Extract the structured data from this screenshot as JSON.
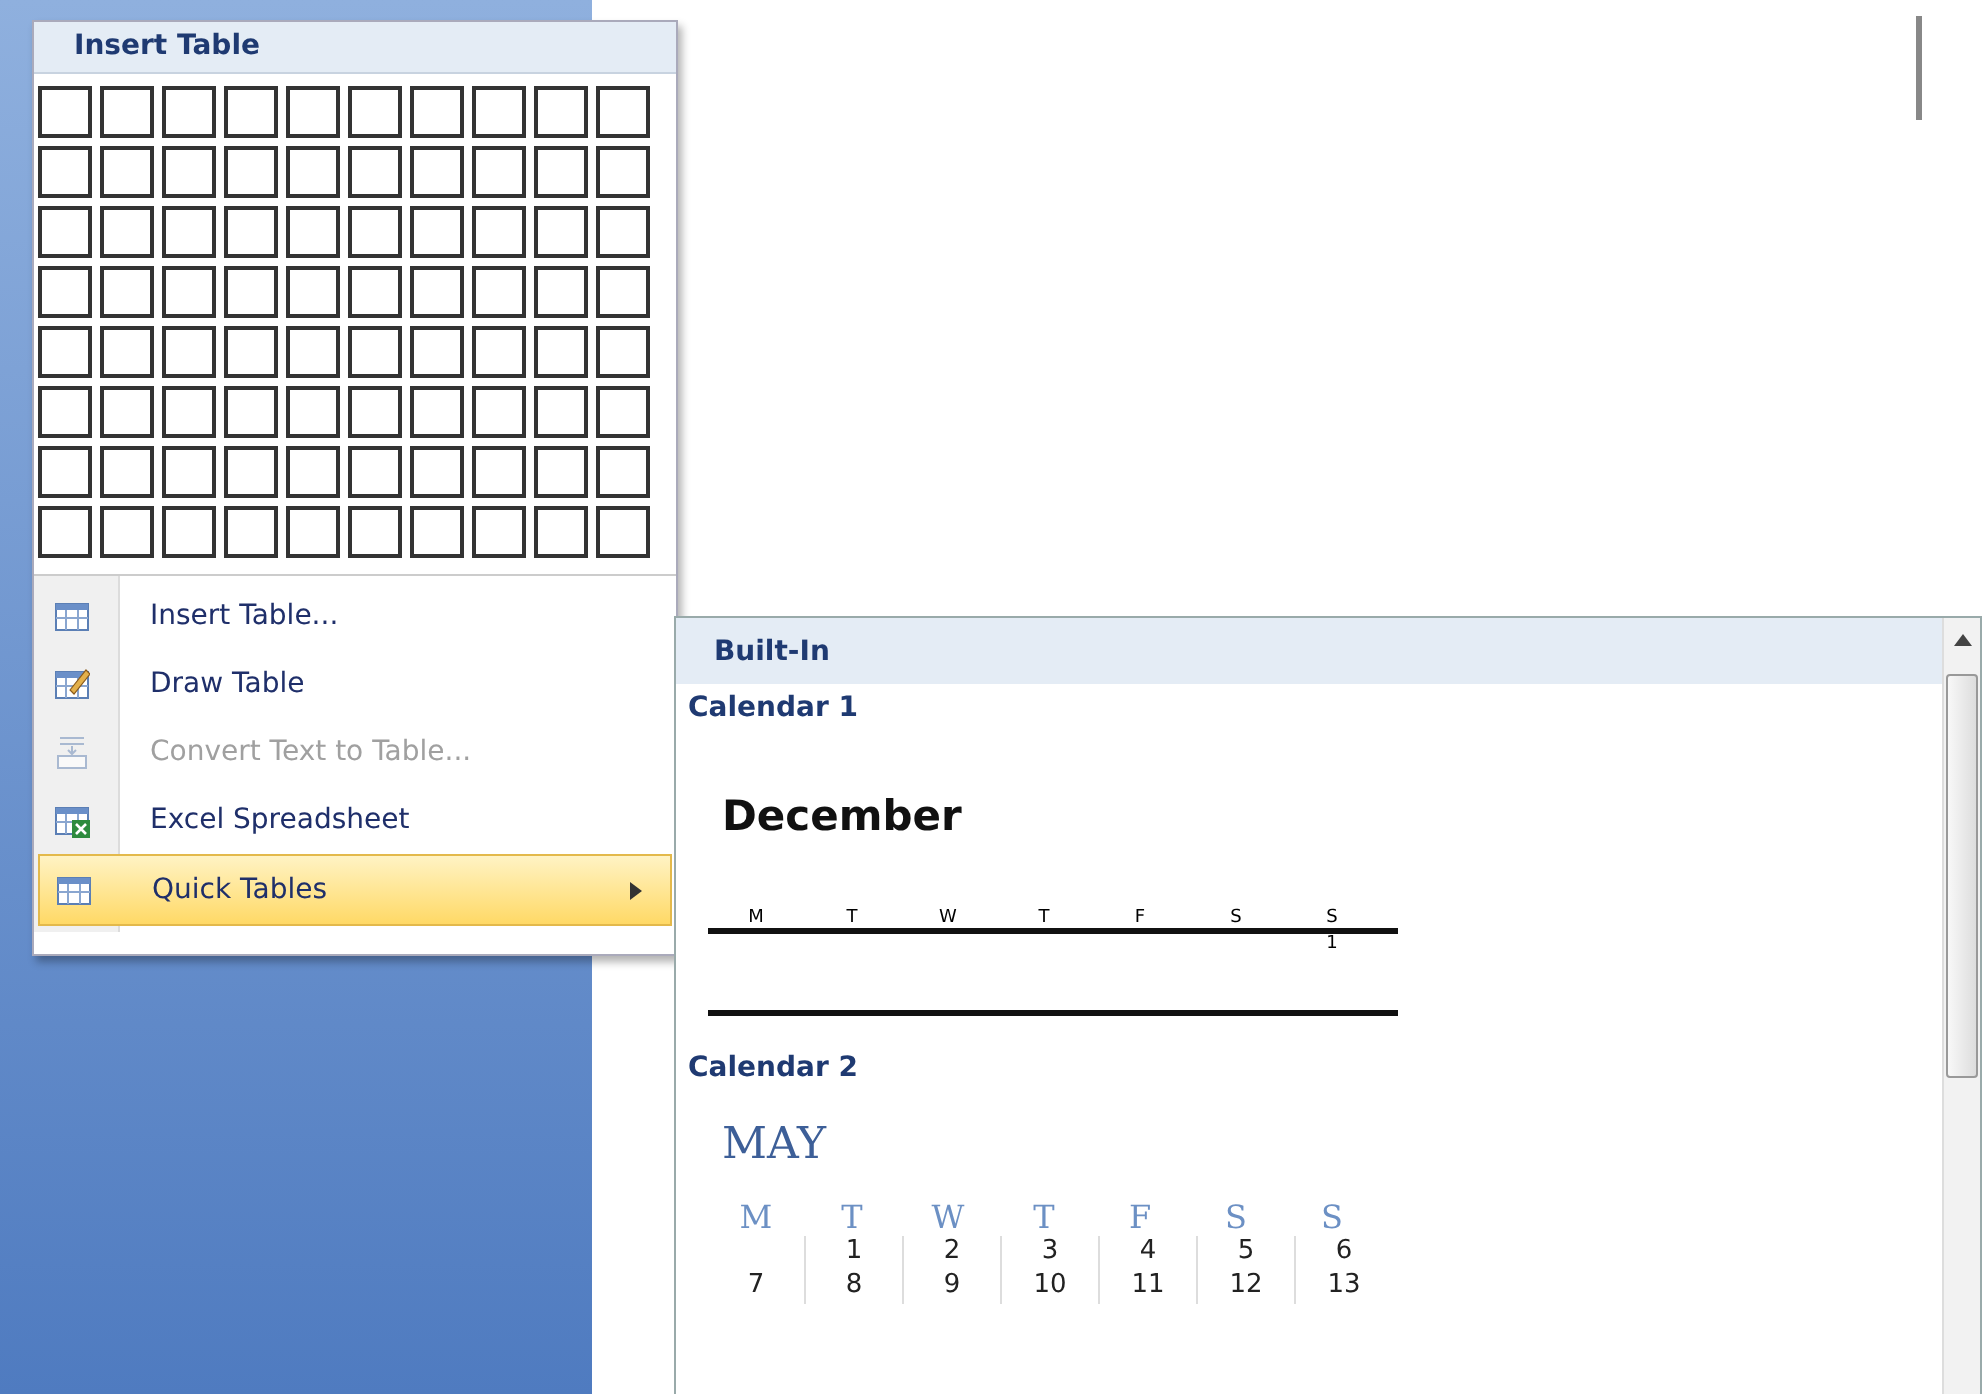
{
  "insert_menu": {
    "title": "Insert Table",
    "items": [
      {
        "label": "Insert Table...",
        "kind": "table",
        "disabled": false,
        "selected": false,
        "submenu": false
      },
      {
        "label": "Draw Table",
        "kind": "pencil",
        "disabled": false,
        "selected": false,
        "submenu": false
      },
      {
        "label": "Convert Text to Table...",
        "kind": "convert",
        "disabled": true,
        "selected": false,
        "submenu": false
      },
      {
        "label": "Excel Spreadsheet",
        "kind": "excel",
        "disabled": false,
        "selected": false,
        "submenu": false
      },
      {
        "label": "Quick Tables",
        "kind": "table",
        "disabled": false,
        "selected": true,
        "submenu": true
      }
    ]
  },
  "quick_tables": {
    "section": "Built-In",
    "calendars": [
      {
        "name": "Calendar 1",
        "kind": "plain",
        "month": "December",
        "days": [
          "M",
          "T",
          "W",
          "T",
          "F",
          "S",
          "S"
        ],
        "weeks": [
          {
            "kind": "tail",
            "days": [
              "1"
            ]
          }
        ]
      },
      {
        "name": "Calendar 2",
        "kind": "serif",
        "month": "MAY",
        "days": [
          "M",
          "T",
          "W",
          "T",
          "F",
          "S",
          "S"
        ],
        "weeks": [
          {
            "kind": "tail",
            "days": [
              "1",
              "2",
              "3",
              "4",
              "5",
              "6"
            ]
          },
          {
            "kind": "head",
            "days": [
              "7",
              "8",
              "9",
              "10",
              "11",
              "12",
              "13"
            ]
          }
        ]
      }
    ]
  }
}
